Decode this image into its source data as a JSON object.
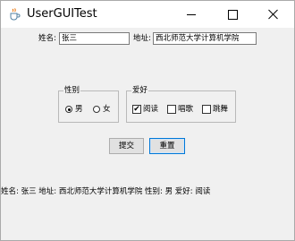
{
  "window": {
    "title": "UserGUITest",
    "title_bar_color": "#ffffff",
    "content_background": "#f0f0f0"
  },
  "form": {
    "name_label": "姓名:",
    "name_value": "张三",
    "address_label": "地址:",
    "address_value": "西北师范大学计算机学院"
  },
  "gender": {
    "title": "性别",
    "options": [
      {
        "label": "男",
        "selected": true
      },
      {
        "label": "女",
        "selected": false
      }
    ]
  },
  "hobbies": {
    "title": "爱好",
    "options": [
      {
        "label": "阅读",
        "checked": true
      },
      {
        "label": "唱歌",
        "checked": false
      },
      {
        "label": "跳舞",
        "checked": false
      }
    ]
  },
  "buttons": {
    "submit": "提交",
    "reset": "重置"
  },
  "status": {
    "text": "姓名: 张三  地址: 西北师范大学计算机学院 性别: 男 爱好: 阅读"
  },
  "icons": {
    "app": "java-cup-icon",
    "minimize": "minimize-icon",
    "maximize": "maximize-icon",
    "close": "close-icon"
  }
}
